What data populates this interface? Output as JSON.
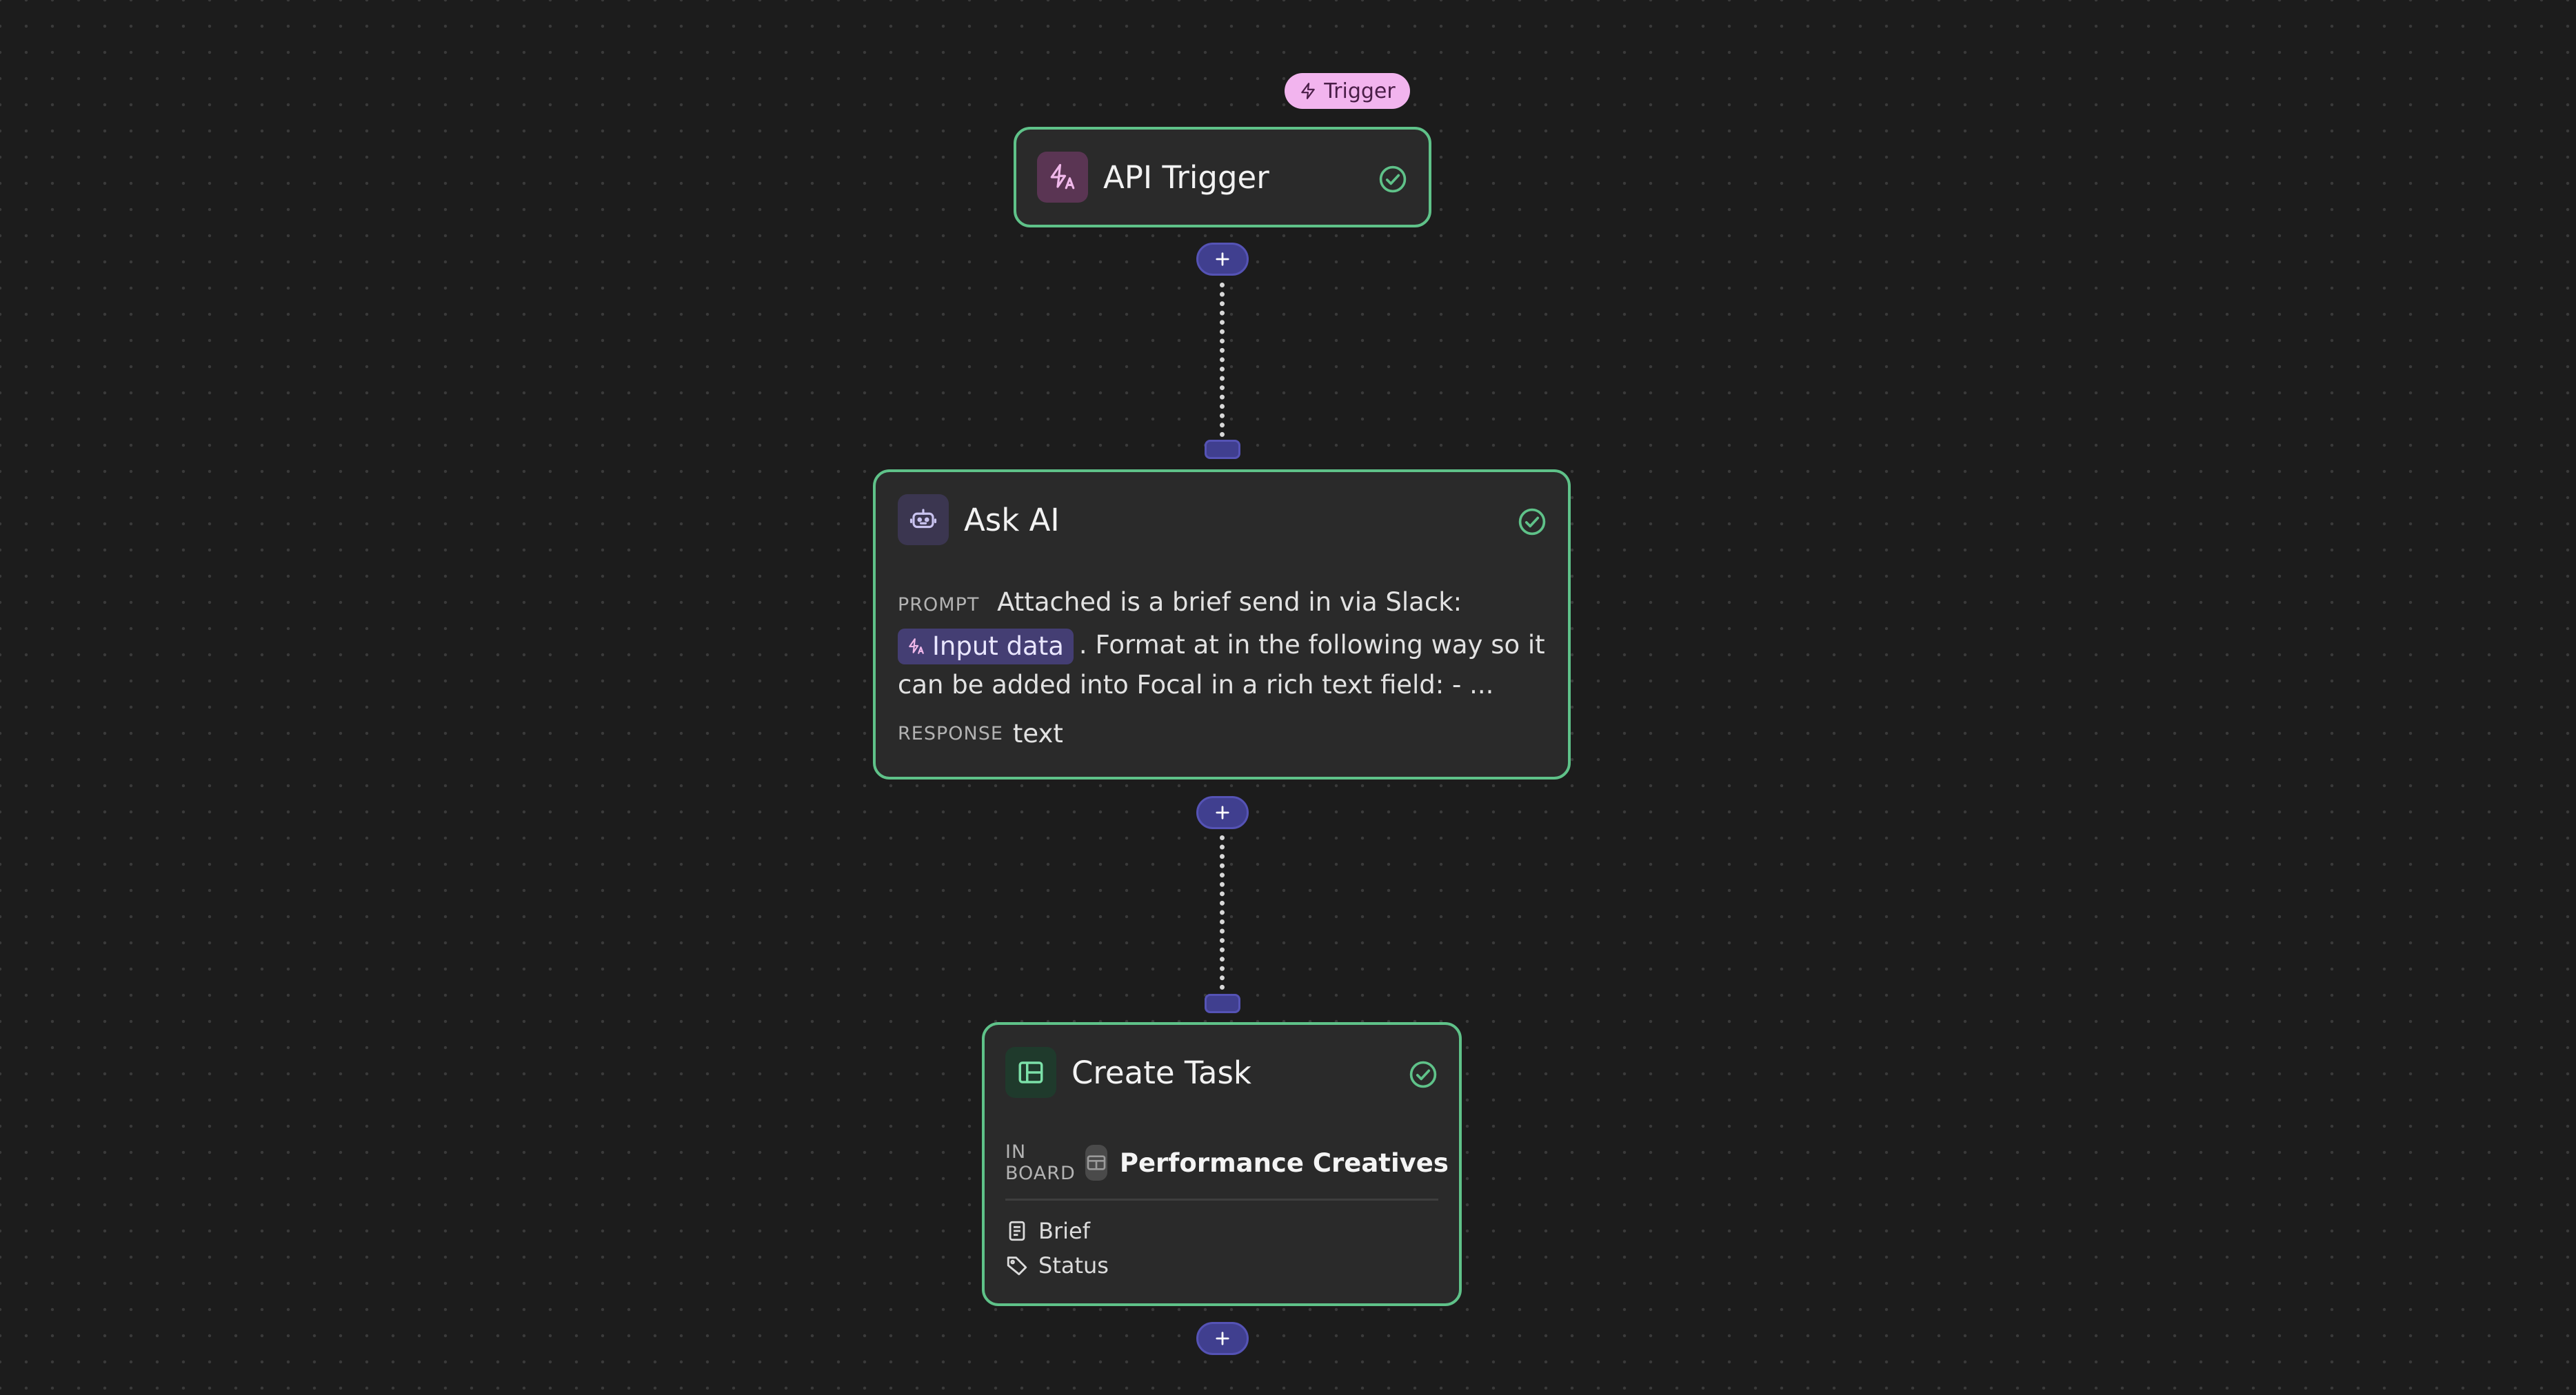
{
  "trigger_badge": {
    "label": "Trigger",
    "icon": "bolt-icon"
  },
  "nodes": {
    "api_trigger": {
      "title": "API Trigger",
      "icon": "api-trigger-icon",
      "status": "complete"
    },
    "ask_ai": {
      "title": "Ask AI",
      "icon": "robot-icon",
      "status": "complete",
      "prompt_label": "PROMPT",
      "prompt_text_before": "Attached is a brief send in via Slack:",
      "prompt_chip": "Input data",
      "prompt_text_after": ". Format at in the following way so it can be added into Focal in a rich text field: - ...",
      "response_label": "RESPONSE",
      "response_value": "text"
    },
    "create_task": {
      "title": "Create Task",
      "icon": "board-layout-icon",
      "status": "complete",
      "board_label": "IN BOARD",
      "board_name": "Performance Creatives",
      "fields": [
        {
          "label": "Brief",
          "icon": "document-icon"
        },
        {
          "label": "Status",
          "icon": "tag-icon"
        }
      ]
    }
  },
  "colors": {
    "canvas_bg": "#1c1c1c",
    "node_border": "#5fc289",
    "node_bg": "#2a2a2a",
    "trigger_badge": "#f2b4ee",
    "connector": "#403f8f",
    "chip_bg": "#443e73"
  }
}
